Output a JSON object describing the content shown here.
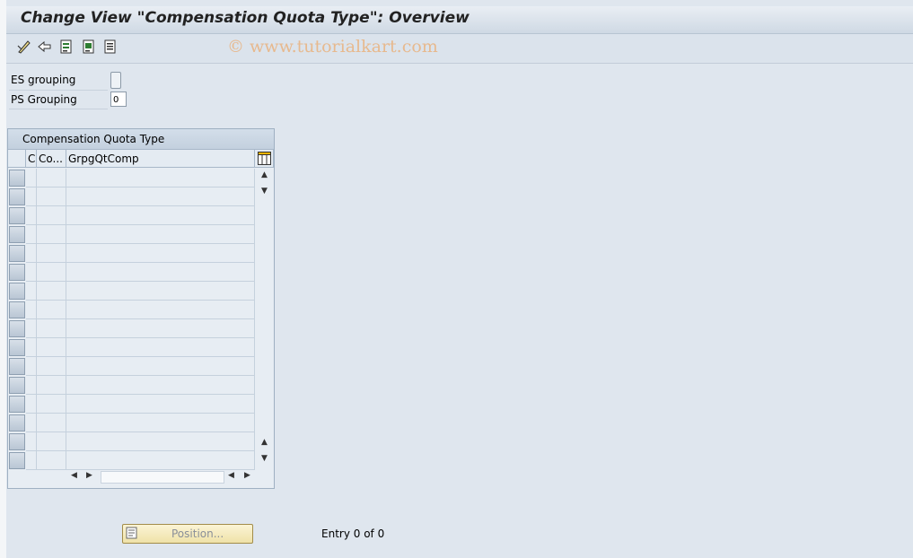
{
  "window": {
    "title": "Change View \"Compensation Quota Type\": Overview"
  },
  "toolbar": {
    "icons": [
      "edit-pen-icon",
      "undo-icon",
      "details-icon",
      "select-all-icon",
      "deselect-icon"
    ],
    "watermark": "© www.tutorialkart.com"
  },
  "fields": {
    "es_grouping": {
      "label": "ES grouping",
      "value": ""
    },
    "ps_grouping": {
      "label": "PS Grouping",
      "value": "0"
    }
  },
  "table": {
    "title": "Compensation Quota Type",
    "columns": [
      "C",
      "Co...",
      "GrpgQtComp"
    ],
    "row_count": 16
  },
  "footer": {
    "position_button": "Position...",
    "entry_text": "Entry 0 of 0"
  }
}
